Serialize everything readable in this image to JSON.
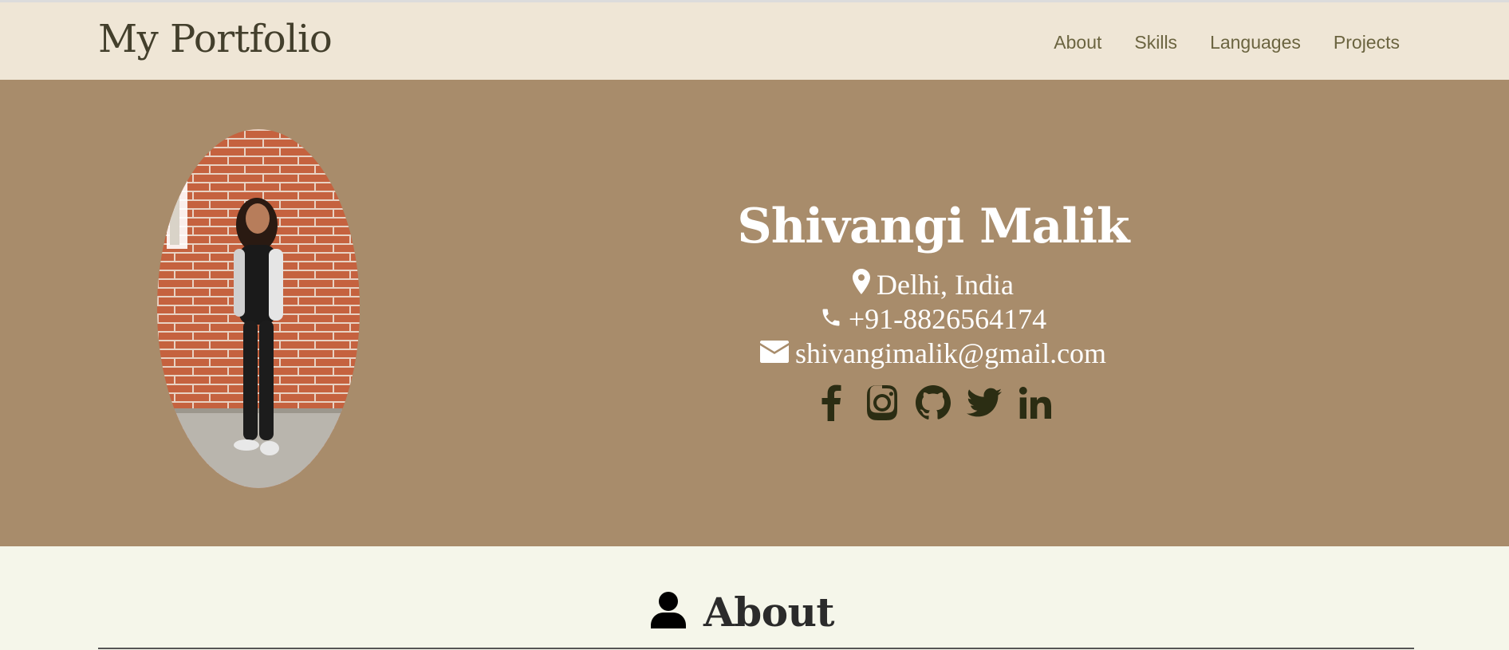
{
  "brand": "My Portfolio",
  "nav": {
    "items": [
      "About",
      "Skills",
      "Languages",
      "Projects"
    ]
  },
  "hero": {
    "name": "Shivangi Malik",
    "location": "Delhi, India",
    "phone": "+91-8826564174",
    "email": "shivangimalik@gmail.com",
    "photo_icon": "profile-photo",
    "social_icons": [
      "facebook-icon",
      "instagram-icon",
      "github-icon",
      "twitter-icon",
      "linkedin-icon"
    ]
  },
  "about": {
    "title": "About",
    "icon": "user-icon"
  },
  "colors": {
    "navbar_bg": "#efe6d6",
    "nav_underline": "#2f6625",
    "hero_bg": "#a88c6b",
    "page_bg": "#f5f6ea",
    "social_icon": "#2b2d13",
    "nav_text": "#6b6440"
  }
}
